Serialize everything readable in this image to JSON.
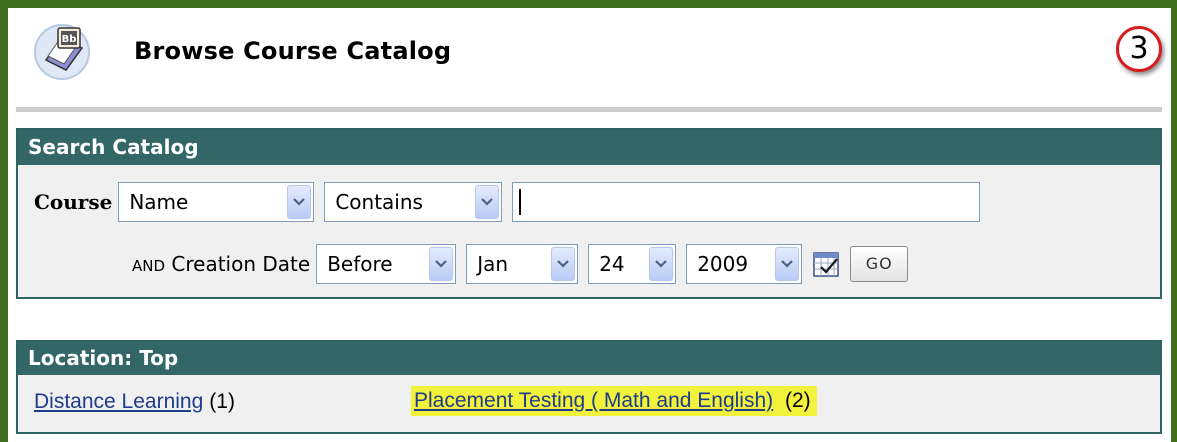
{
  "header": {
    "title": "Browse Course Catalog",
    "step_number": "3",
    "logo_icon": "blackboard-book-icon"
  },
  "search": {
    "panel_title": "Search Catalog",
    "course_label": "Course",
    "field_select": "Name",
    "operator_select": "Contains",
    "search_value": "",
    "and_label_prefix": "AND",
    "and_label_rest": " Creation Date",
    "date_operator": "Before",
    "month": "Jan",
    "day": "24",
    "year": "2009",
    "calendar_icon": "calendar-icon",
    "go_label": "GO"
  },
  "location": {
    "panel_title": "Location: Top",
    "items": [
      {
        "label": "Distance Learning",
        "count": "(1)"
      },
      {
        "label": "Placement Testing ( Math and English)",
        "count": "(2)",
        "highlight": "#f2f23c"
      }
    ]
  },
  "colors": {
    "frame": "#3f6e1e",
    "panel_header": "#336666",
    "link": "#1f3b8c",
    "highlight": "#f2f23c"
  }
}
